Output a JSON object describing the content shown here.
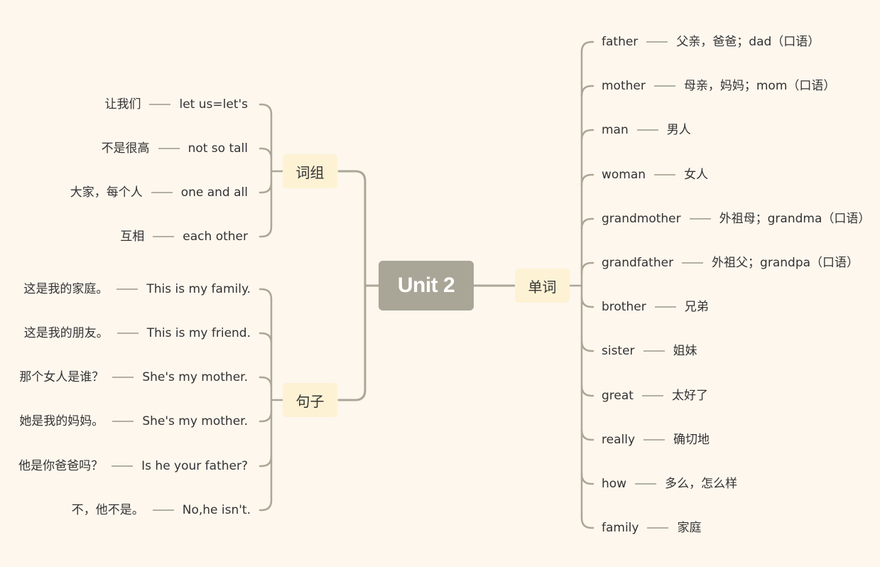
{
  "root": {
    "label": "Unit 2"
  },
  "colors": {
    "background": "#fdf7ee",
    "root_fill": "#a9a697",
    "branch_fill": "#fdf2d4",
    "line": "#aaa796",
    "text": "#333333"
  },
  "branches": {
    "words": {
      "label": "单词",
      "items": [
        {
          "en": "father",
          "zh": "父亲，爸爸；dad（口语）"
        },
        {
          "en": "mother",
          "zh": "母亲，妈妈；mom（口语）"
        },
        {
          "en": "man",
          "zh": "男人"
        },
        {
          "en": "woman",
          "zh": "女人"
        },
        {
          "en": "grandmother",
          "zh": "外祖母；grandma（口语）"
        },
        {
          "en": "grandfather",
          "zh": "外祖父；grandpa（口语）"
        },
        {
          "en": "brother",
          "zh": "兄弟"
        },
        {
          "en": "sister",
          "zh": "姐妹"
        },
        {
          "en": "great",
          "zh": "太好了"
        },
        {
          "en": "really",
          "zh": "确切地"
        },
        {
          "en": "how",
          "zh": "多么，怎么样"
        },
        {
          "en": "family",
          "zh": "家庭"
        }
      ]
    },
    "phrases": {
      "label": "词组",
      "items": [
        {
          "en": "let us=let's",
          "zh": "让我们"
        },
        {
          "en": "not so tall",
          "zh": "不是很高"
        },
        {
          "en": "one and all",
          "zh": "大家，每个人"
        },
        {
          "en": "each other",
          "zh": "互相"
        }
      ]
    },
    "sentences": {
      "label": "句子",
      "items": [
        {
          "en": "This is my family.",
          "zh": "这是我的家庭。"
        },
        {
          "en": "This is my friend.",
          "zh": "这是我的朋友。"
        },
        {
          "en": "She's my mother.",
          "zh": "那个女人是谁？"
        },
        {
          "en": "She's my mother.",
          "zh": "她是我的妈妈。"
        },
        {
          "en": "Is he your father?",
          "zh": "他是你爸爸吗？"
        },
        {
          "en": "No,he isn't.",
          "zh": "不，他不是。"
        }
      ]
    }
  }
}
